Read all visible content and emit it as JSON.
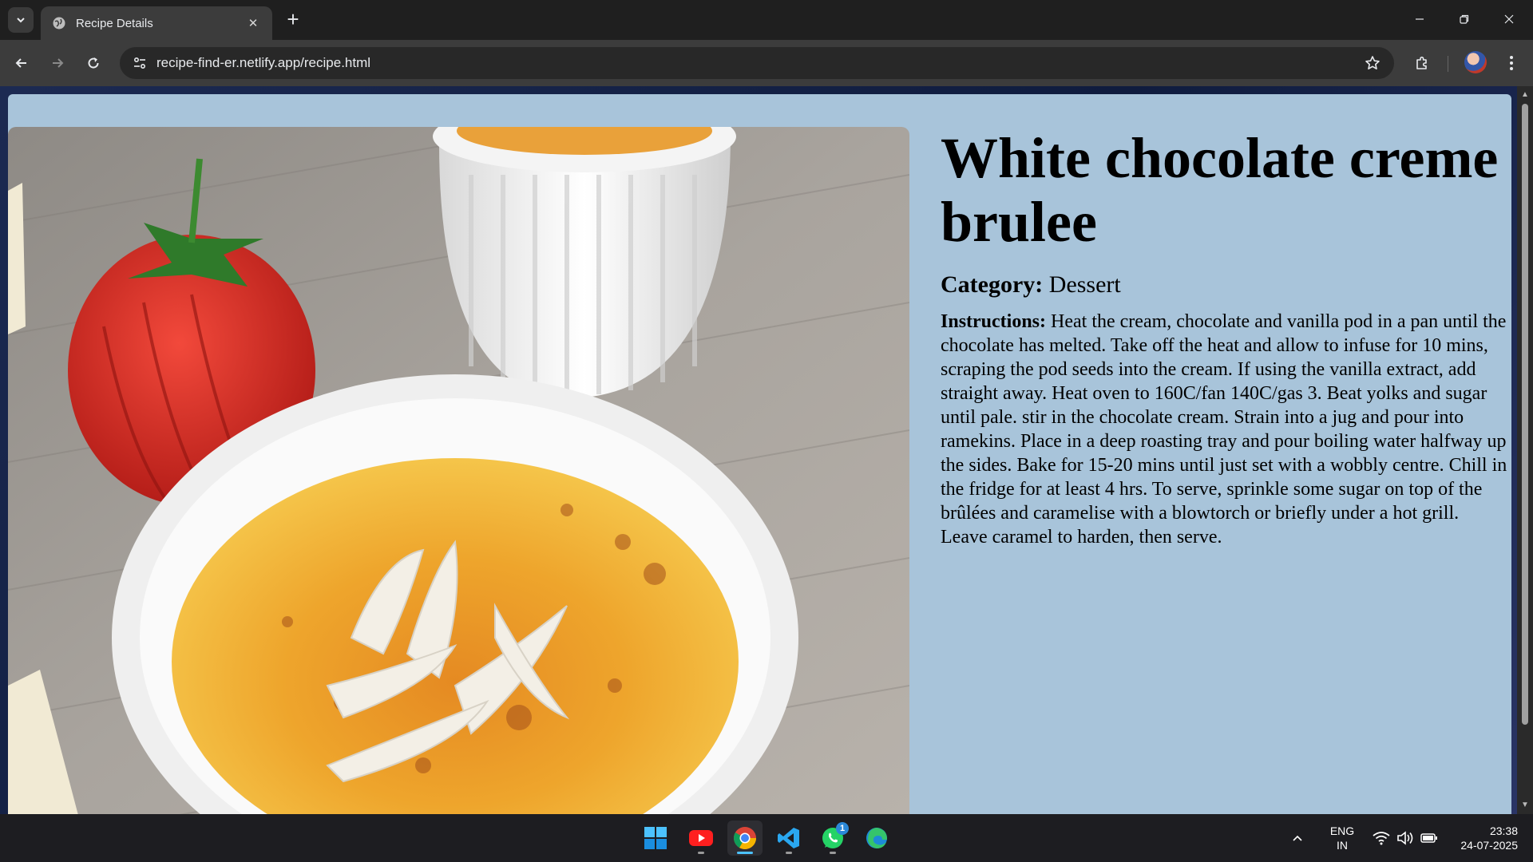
{
  "browser": {
    "tab_title": "Recipe Details",
    "url": "recipe-find-er.netlify.app/recipe.html"
  },
  "recipe": {
    "title": "White chocolate creme brulee",
    "category_label": "Category:",
    "category": "Dessert",
    "instructions_label": "Instructions:",
    "instructions": "Heat the cream, chocolate and vanilla pod in a pan until the chocolate has melted. Take off the heat and allow to infuse for 10 mins, scraping the pod seeds into the cream. If using the vanilla extract, add straight away. Heat oven to 160C/fan 140C/gas 3. Beat yolks and sugar until pale. stir in the chocolate cream. Strain into a jug and pour into ramekins. Place in a deep roasting tray and pour boiling water halfway up the sides. Bake for 15-20 mins until just set with a wobbly centre. Chill in the fridge for at least 4 hrs. To serve, sprinkle some sugar on top of the brûlées and caramelise with a blowtorch or briefly under a hot grill. Leave caramel to harden, then serve."
  },
  "taskbar": {
    "apps": [
      "windows-start",
      "youtube",
      "chrome",
      "vscode",
      "whatsapp",
      "edge"
    ],
    "whatsapp_badge": "1",
    "language_line1": "ENG",
    "language_line2": "IN",
    "time": "23:38",
    "date": "24-07-2025"
  },
  "colors": {
    "card_bg": "#a8c4da",
    "chrome_dark": "#1f1f1f",
    "toolbar": "#3c3c3c",
    "taskbar": "#1d1d21"
  }
}
